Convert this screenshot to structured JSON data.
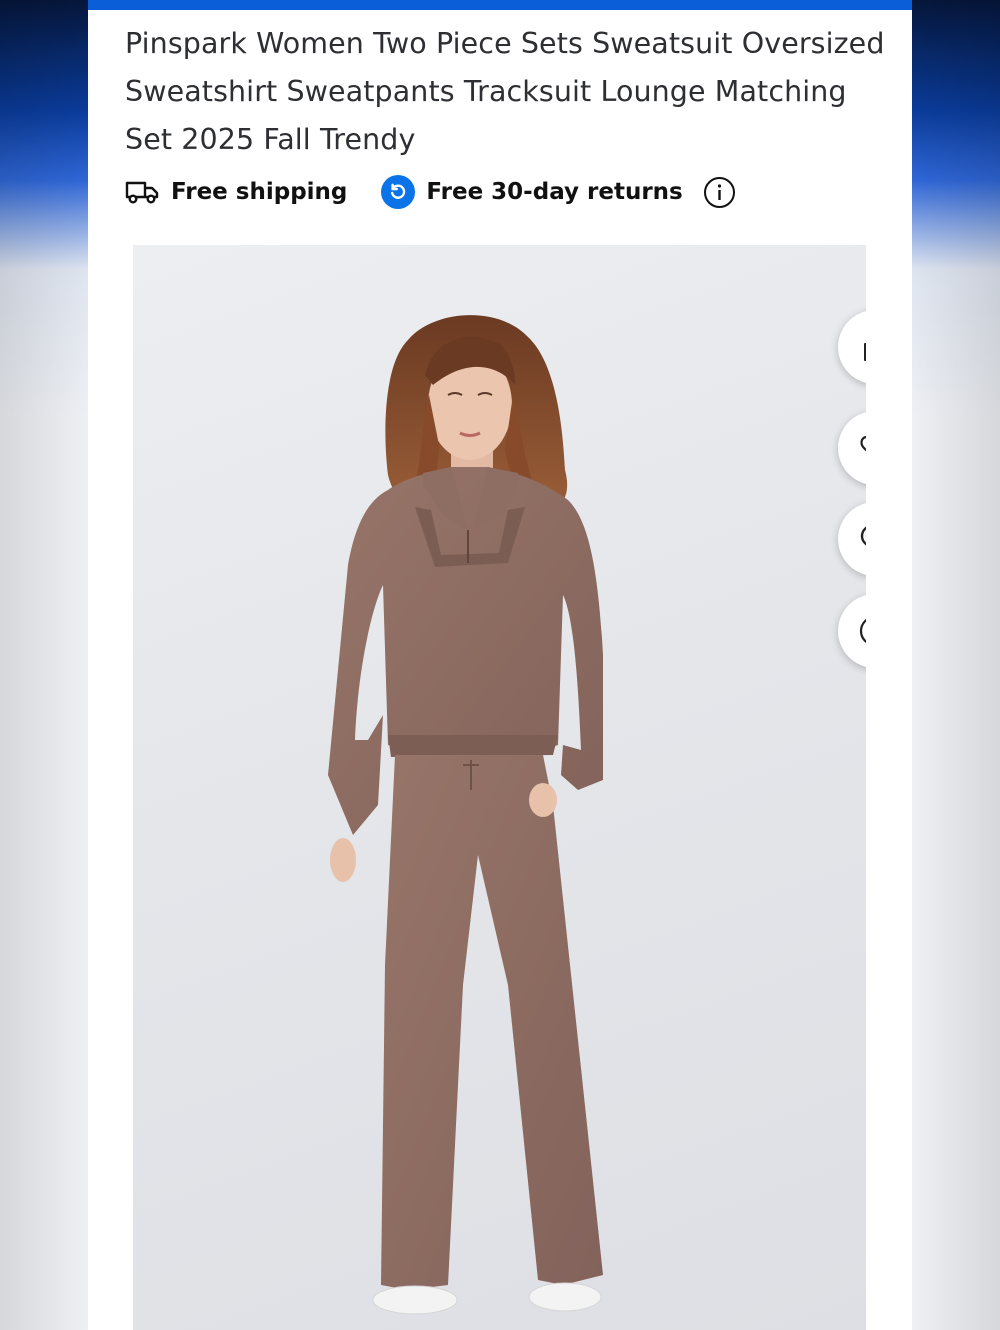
{
  "product": {
    "title": "Pinspark Women Two Piece Sets Sweatsuit Oversized Sweatshirt Sweatpants Tracksuit Lounge Matching Set 2025 Fall Trendy"
  },
  "badges": {
    "shipping_label": "Free shipping",
    "returns_label": "Free 30-day returns"
  },
  "image_actions": [
    "share-icon",
    "heart-icon",
    "zoom-in-icon",
    "play-icon"
  ],
  "colors": {
    "accent": "#0a5ed7",
    "returns_icon": "#0a73e8",
    "garment": "#8b6b60",
    "background_panel": "#ffffff"
  },
  "icons": {
    "shipping": "truck-icon",
    "returns": "returns-icon",
    "info": "info-icon"
  }
}
